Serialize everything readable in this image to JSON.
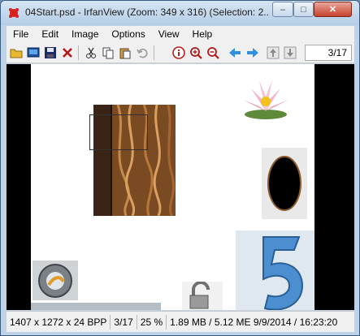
{
  "window": {
    "title": "04Start.psd - IrfanView (Zoom: 349 x 316) (Selection: 2...",
    "minimize_glyph": "–",
    "maximize_glyph": "□",
    "close_glyph": "✕"
  },
  "menu": {
    "items": [
      "File",
      "Edit",
      "Image",
      "Options",
      "View",
      "Help"
    ]
  },
  "toolbar": {
    "icons": [
      "open-folder-icon",
      "slideshow-icon",
      "save-icon",
      "delete-icon",
      "cut-icon",
      "copy-icon",
      "paste-icon",
      "undo-icon",
      "info-icon",
      "zoom-in-icon",
      "zoom-out-icon",
      "previous-arrow-icon",
      "next-arrow-icon",
      "first-icon",
      "last-icon"
    ],
    "page_counter": "3/17"
  },
  "status": {
    "dimensions": "1407 x 1272 x 24 BPP",
    "index": "3/17",
    "zoom": "25 %",
    "memory_date": "1.89 MB / 5.12 ME 9/9/2014 / 16:23:20"
  },
  "colors": {
    "title_bar": "#c5d9ee",
    "close_button": "#c6422c",
    "viewer_background": "#000000",
    "accent_arrow": "#2f8fe0"
  }
}
